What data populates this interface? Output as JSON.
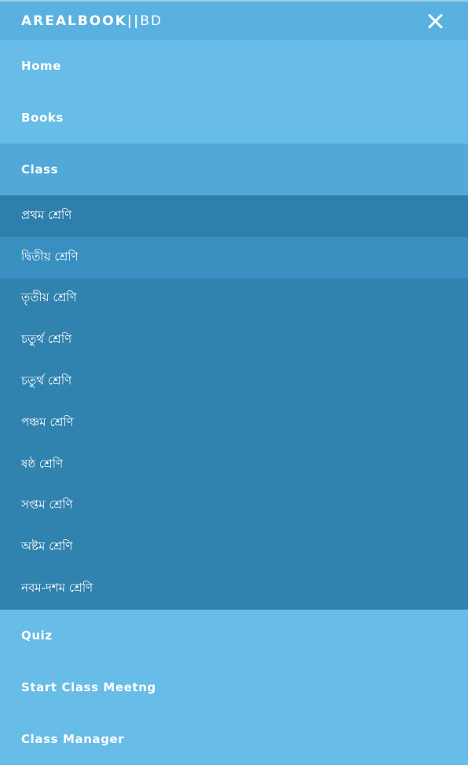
{
  "brand": {
    "bold": "AREALBOOK||",
    "thin": "BD"
  },
  "menu": {
    "top": [
      {
        "label": "Home"
      },
      {
        "label": "Books"
      },
      {
        "label": "Class"
      }
    ],
    "classes": [
      "প্রথম শ্রেণি",
      "দ্বিতীয় শ্রেণি",
      "তৃতীয় শ্রেণি",
      "চতুর্থ শ্রেণি",
      "চতুর্থ শ্রেণি",
      "পঞ্চম শ্রেণি",
      "ষষ্ঠ শ্রেণি",
      "সপ্তম শ্রেণি",
      "অষ্টম শ্রেণি",
      "নবম-দশম শ্রেণি"
    ],
    "bottom": [
      {
        "label": "Quiz"
      },
      {
        "label": "Start Class Meetng"
      },
      {
        "label": "Class Manager"
      }
    ]
  },
  "colors": {
    "menu_bg": "#68bce8",
    "header_bg": "#59b1e0",
    "active_bg": "#50a9d9",
    "submenu_bg": "#3083ae",
    "submenu_highlight": "#388fc0"
  }
}
